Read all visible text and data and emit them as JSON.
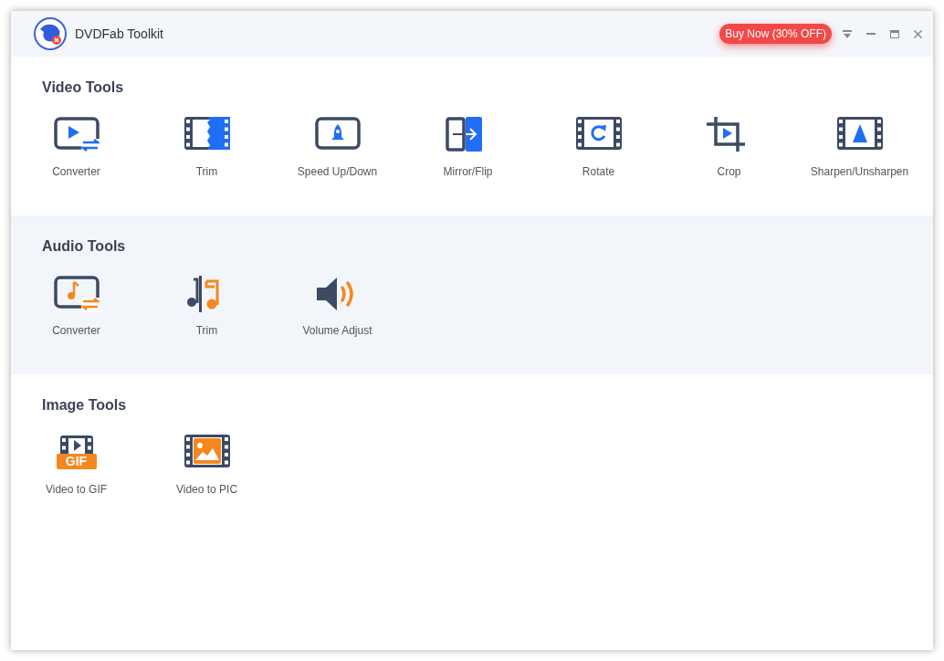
{
  "window": {
    "title": "DVDFab Toolkit",
    "promo_button": "Buy Now (30% OFF)"
  },
  "sections": [
    {
      "title": "Video Tools",
      "shaded": false,
      "tools": [
        {
          "label": "Converter",
          "kind": "video-convert"
        },
        {
          "label": "Trim",
          "kind": "video-trim"
        },
        {
          "label": "Speed Up/Down",
          "kind": "speed"
        },
        {
          "label": "Mirror/Flip",
          "kind": "mirror"
        },
        {
          "label": "Rotate",
          "kind": "rotate"
        },
        {
          "label": "Crop",
          "kind": "crop"
        },
        {
          "label": "Sharpen/Unsharpen",
          "kind": "sharpen"
        }
      ]
    },
    {
      "title": "Audio Tools",
      "shaded": true,
      "tools": [
        {
          "label": "Converter",
          "kind": "audio-convert"
        },
        {
          "label": "Trim",
          "kind": "audio-trim"
        },
        {
          "label": "Volume Adjust",
          "kind": "volume"
        }
      ]
    },
    {
      "title": "Image Tools",
      "shaded": false,
      "tools": [
        {
          "label": "Video to GIF",
          "kind": "gif",
          "icon_text": "GIF"
        },
        {
          "label": "Video to PIC",
          "kind": "pic"
        }
      ]
    }
  ]
}
